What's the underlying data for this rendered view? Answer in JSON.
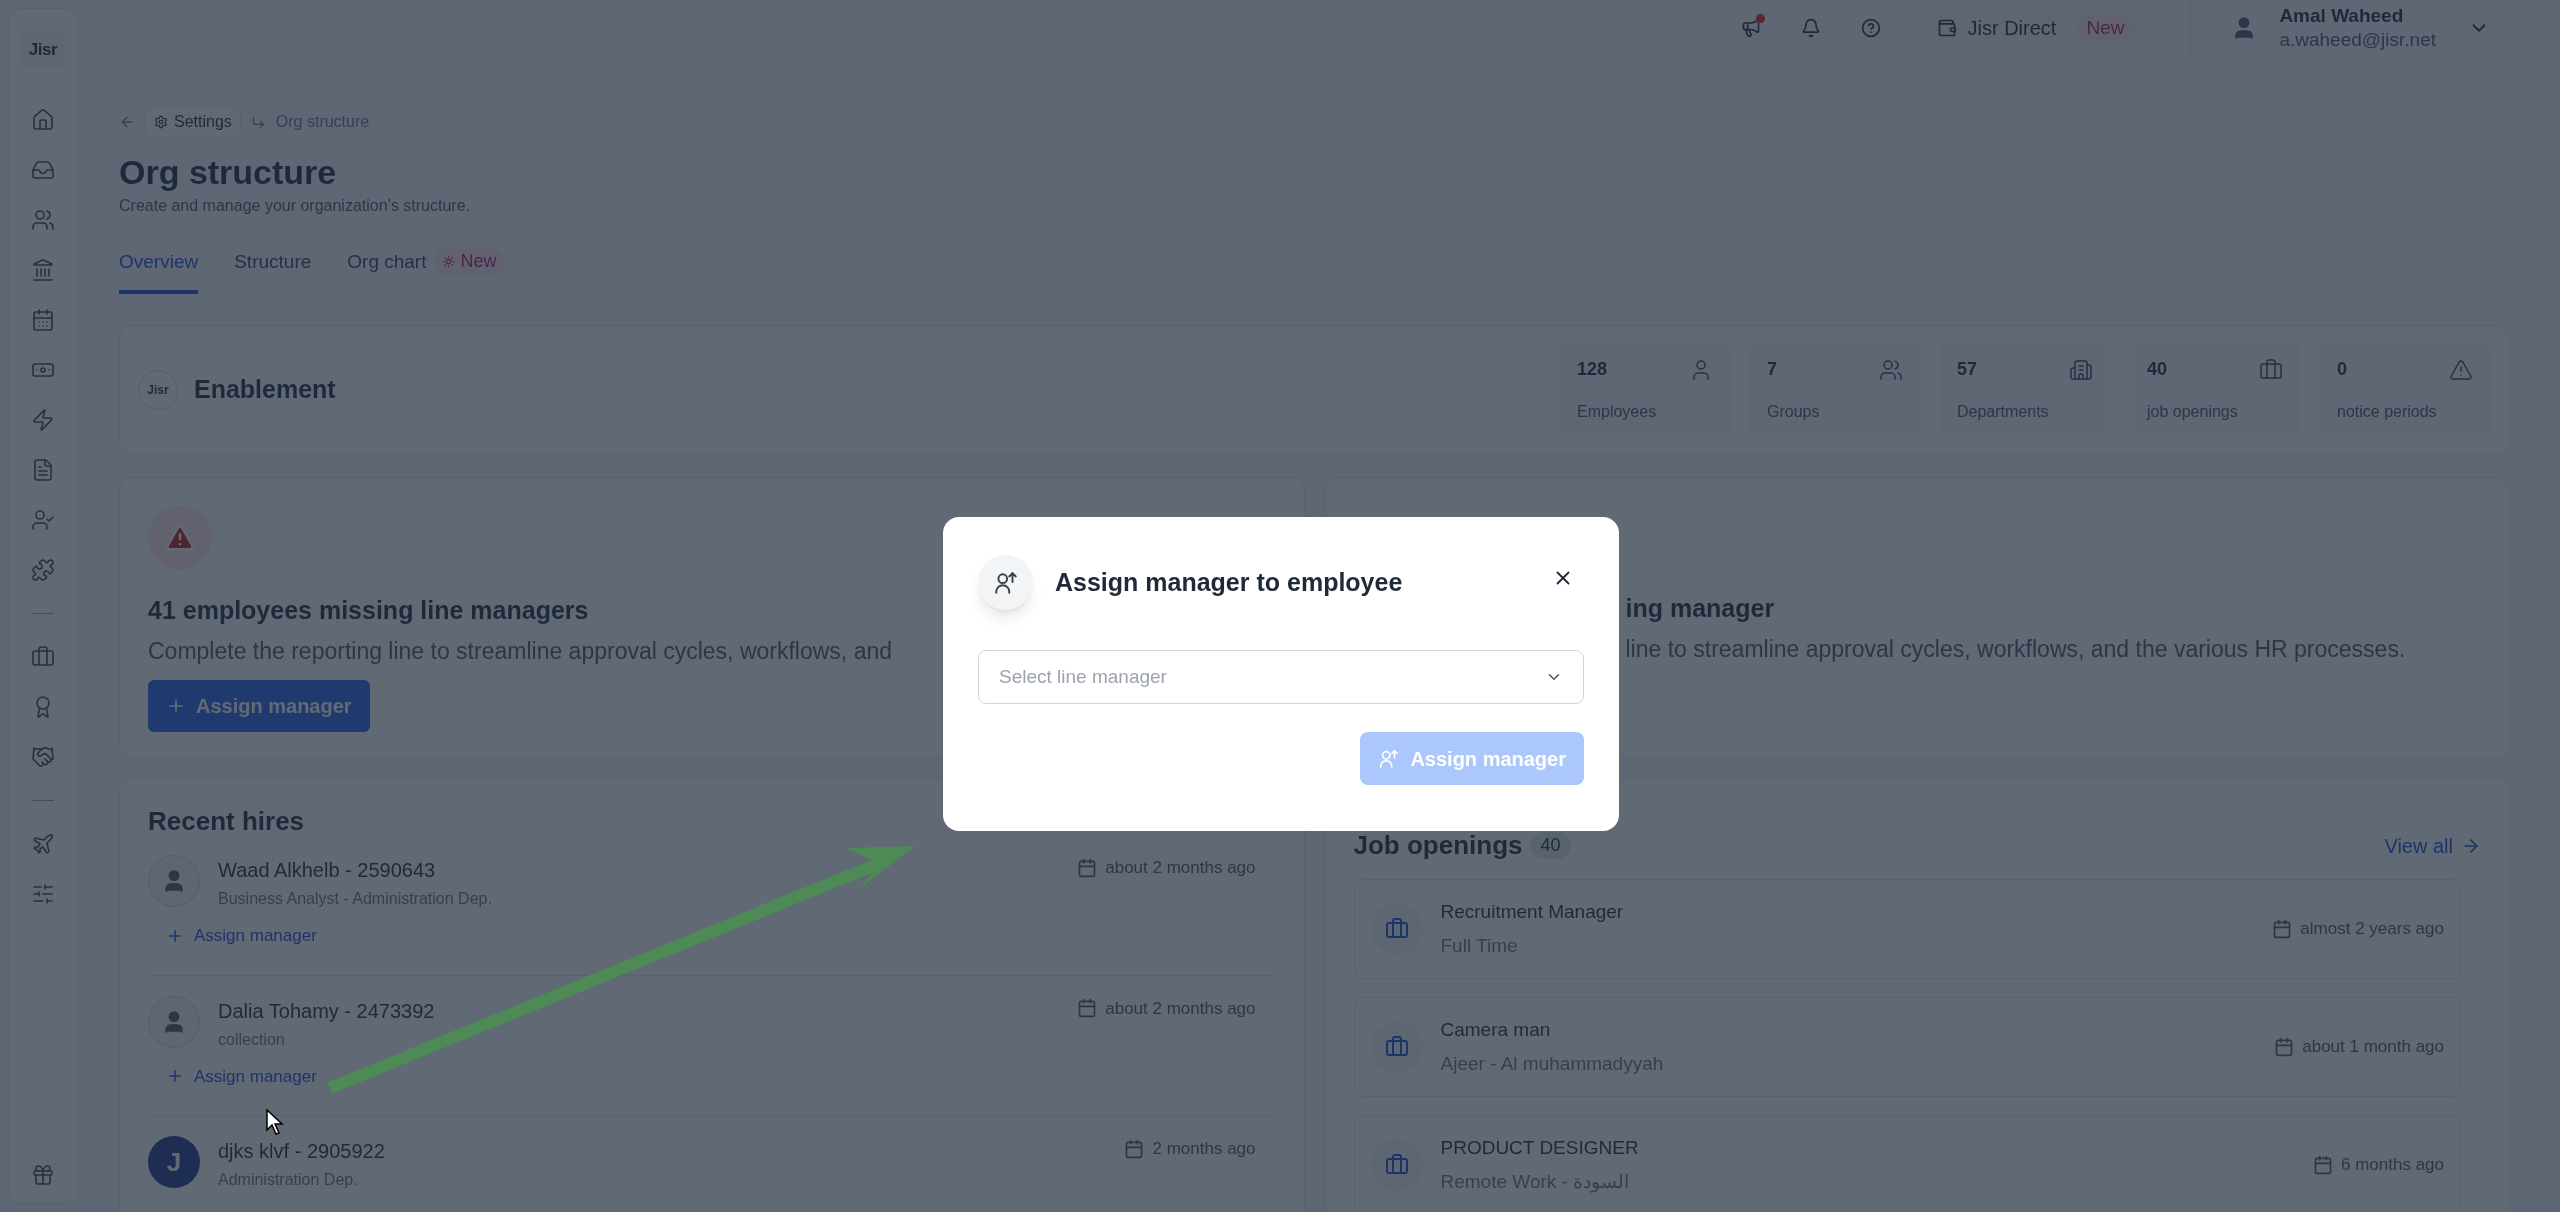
{
  "sidebar": {
    "logo": "Jisr",
    "items": [
      {
        "kind": "home"
      },
      {
        "kind": "inbox"
      },
      {
        "kind": "people"
      },
      {
        "kind": "bank"
      },
      {
        "kind": "calendar"
      },
      {
        "kind": "cash"
      },
      {
        "kind": "bolt"
      },
      {
        "kind": "report"
      },
      {
        "kind": "user-check"
      },
      {
        "kind": "puzzle"
      },
      {
        "kind": "divider"
      },
      {
        "kind": "briefcase"
      },
      {
        "kind": "medal"
      },
      {
        "kind": "handshake"
      },
      {
        "kind": "divider"
      },
      {
        "kind": "plane"
      },
      {
        "kind": "sliders"
      }
    ]
  },
  "top_bar": {
    "jisr_direct": {
      "label": "Jisr Direct",
      "badge": "New"
    },
    "user": {
      "name": "Amal Waheed",
      "email": "a.waheed@jisr.net"
    }
  },
  "breadcrumb": {
    "parent": "Settings",
    "current": "Org structure"
  },
  "page": {
    "title": "Org structure",
    "subtitle": "Create and manage your organization’s structure."
  },
  "tabs": [
    {
      "label": "Overview",
      "selected": true
    },
    {
      "label": "Structure",
      "selected": false
    },
    {
      "label": "Org chart",
      "selected": false,
      "badge": "New"
    }
  ],
  "enablement": {
    "logo": "Jisr",
    "title": "Enablement",
    "stats": [
      {
        "value": "128",
        "label": "Employees",
        "kind": "person"
      },
      {
        "value": "7",
        "label": "Groups",
        "kind": "group"
      },
      {
        "value": "57",
        "label": "Departments",
        "kind": "building"
      },
      {
        "value": "40",
        "label": "job openings",
        "kind": "briefcase"
      },
      {
        "value": "0",
        "label": "notice periods",
        "kind": "warning"
      }
    ]
  },
  "missing_managers_card": {
    "title": "41 employees missing line managers",
    "text": "Complete the reporting line to streamline approval cycles, workflows, and",
    "button": "Assign manager"
  },
  "second_card": {
    "title": "ing manager",
    "text": "line to streamline approval cycles, workflows, and the various HR processes."
  },
  "recent_hires": {
    "title": "Recent hires",
    "items": [
      {
        "name": "Waad Alkhelb - 2590643",
        "subtitle": "Business Analyst - Administration Dep.",
        "date": "about 2 months ago",
        "action": "Assign manager"
      },
      {
        "name": "Dalia Tohamy - 2473392",
        "subtitle": "collection",
        "date": "about 2 months ago",
        "action": "Assign manager"
      },
      {
        "name": "djks klvf - 2905922",
        "subtitle": "Administration Dep.",
        "date": "2 months ago",
        "avatar_initial": "J"
      }
    ]
  },
  "job_openings": {
    "title": "Job openings",
    "count": "40",
    "view_all": "View all",
    "items": [
      {
        "title": "Recruitment Manager",
        "subtitle": "Full Time",
        "date": "almost 2 years ago"
      },
      {
        "title": "Camera man",
        "subtitle": "Ajeer - Al muhammadyyah",
        "date": "about 1 month ago"
      },
      {
        "title": "PRODUCT DESIGNER",
        "subtitle": "Remote Work - السودة",
        "date": "6 months ago"
      }
    ]
  },
  "dialog": {
    "title": "Assign manager to employee",
    "select": {
      "placeholder": "Select line manager"
    },
    "button": {
      "label": "Assign manager",
      "disabled": true
    }
  }
}
